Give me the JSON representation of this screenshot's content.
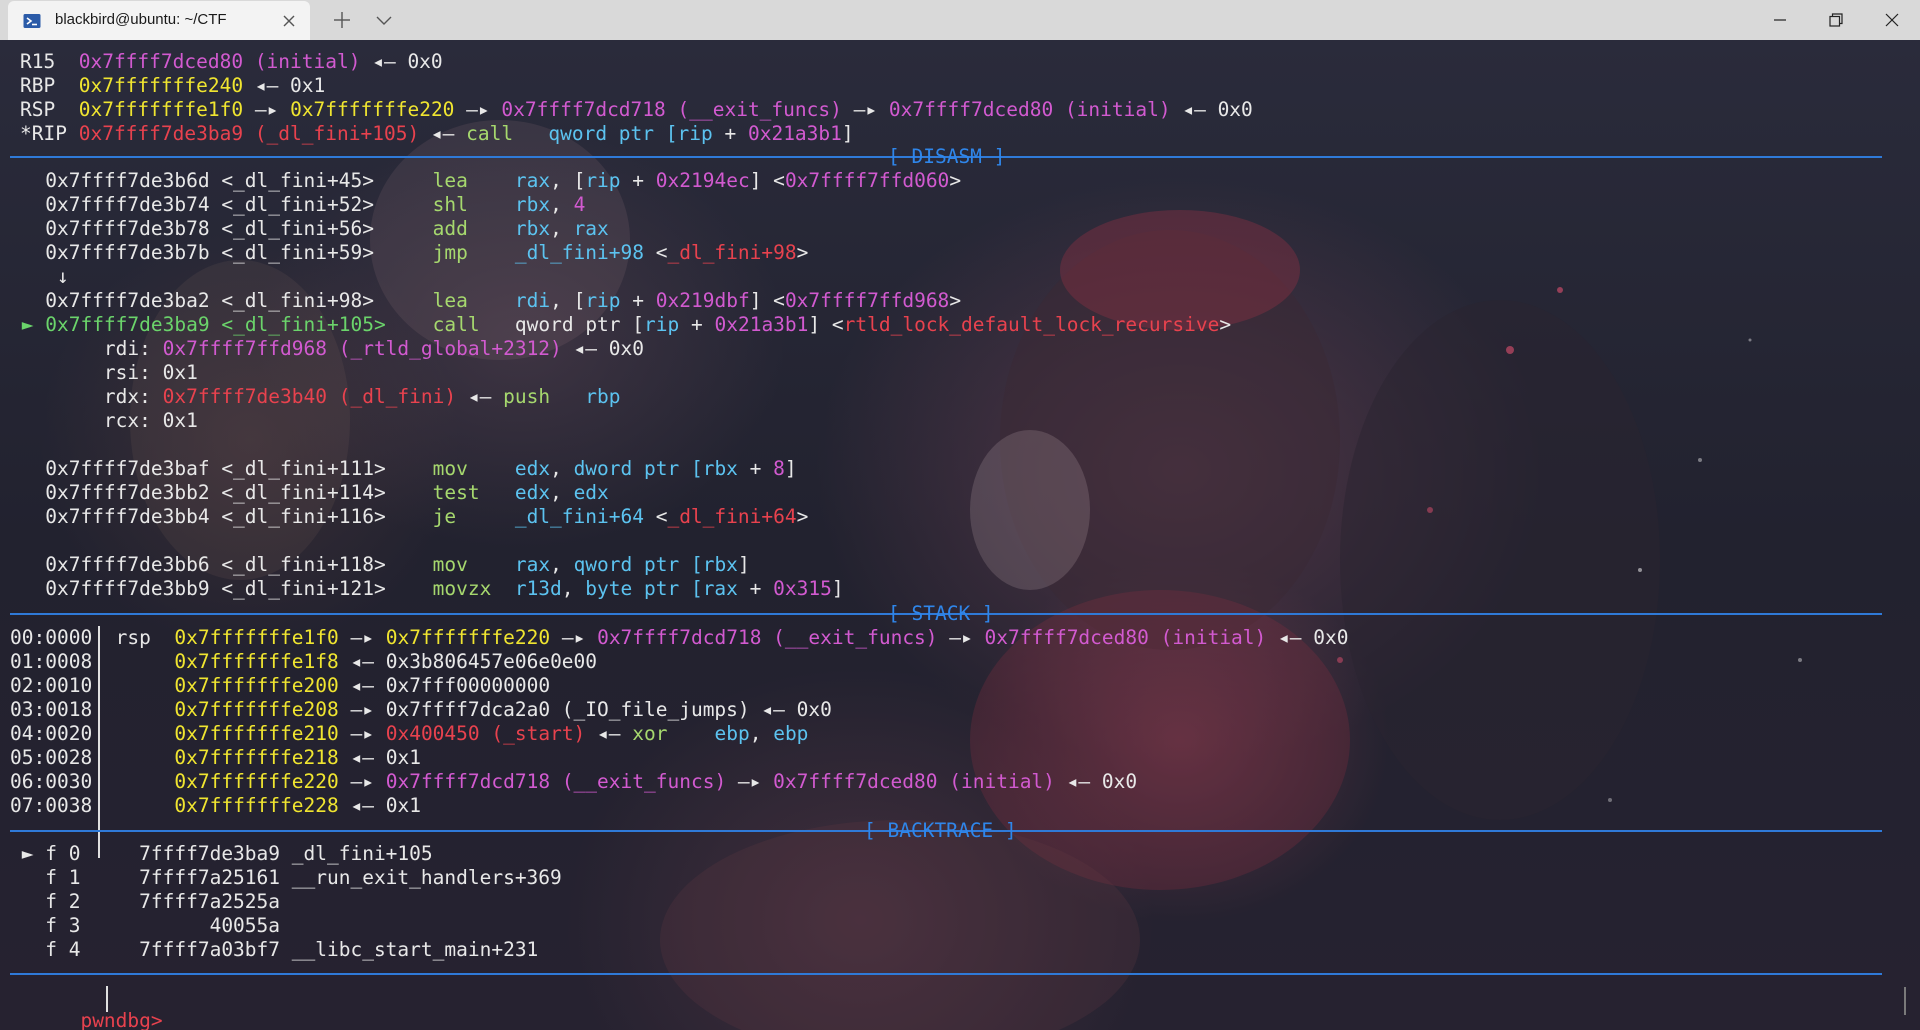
{
  "window": {
    "tab_title": "blackbird@ubuntu: ~/CTF",
    "tab_icon": "terminal-icon"
  },
  "colors": {
    "address_yellow": "#f0e530",
    "symbol_magenta": "#d25ad0",
    "code_red": "#e8424e",
    "current_green": "#6bd46b",
    "mnemonic_green": "#a6d86e",
    "operand_cyan": "#5cc3f0",
    "separator_blue": "#2f7ad8"
  },
  "registers": [
    [
      [
        "R15",
        "w"
      ],
      [
        "  ",
        "w"
      ],
      [
        "0x7ffff7dced80 (initial)",
        "mag"
      ],
      [
        " ◂— 0x0",
        "w"
      ]
    ],
    [
      [
        "RBP",
        "w"
      ],
      [
        "  ",
        "w"
      ],
      [
        "0x7fffffffe240",
        "yel"
      ],
      [
        " ◂— 0x1",
        "w"
      ]
    ],
    [
      [
        "RSP",
        "w"
      ],
      [
        "  ",
        "w"
      ],
      [
        "0x7fffffffe1f0",
        "yel"
      ],
      [
        " —▸ ",
        "w"
      ],
      [
        "0x7fffffffe220",
        "yel"
      ],
      [
        " —▸ ",
        "w"
      ],
      [
        "0x7ffff7dcd718 (__exit_funcs)",
        "mag"
      ],
      [
        " —▸ ",
        "w"
      ],
      [
        "0x7ffff7dced80 (initial)",
        "mag"
      ],
      [
        " ◂— 0x0",
        "w"
      ]
    ],
    [
      [
        "*RIP",
        "w"
      ],
      [
        " ",
        "w"
      ],
      [
        "0x7ffff7de3ba9 (_dl_fini+105)",
        "red"
      ],
      [
        " ◂— ",
        "w"
      ],
      [
        "call",
        "lgr"
      ],
      [
        "   ",
        "w"
      ],
      [
        "qword ptr [",
        "cyn"
      ],
      [
        "rip",
        "cyn"
      ],
      [
        " + ",
        "w"
      ],
      [
        "0x21a3b1",
        "mag"
      ],
      [
        "]",
        "w"
      ]
    ]
  ],
  "sections": {
    "disasm": "[ DISASM ]",
    "stack": "[ STACK ]",
    "backtrace": "[ BACKTRACE ]"
  },
  "disasm": [
    [
      [
        "   0x7ffff7de3b6d <_dl_fini+45>     ",
        "w"
      ],
      [
        "lea",
        "lgr"
      ],
      [
        "    ",
        "w"
      ],
      [
        "rax",
        "cyn"
      ],
      [
        ", ",
        "w"
      ],
      [
        "[",
        "w"
      ],
      [
        "rip",
        "cyn"
      ],
      [
        " + ",
        "w"
      ],
      [
        "0x2194ec",
        "mag"
      ],
      [
        "] <",
        "w"
      ],
      [
        "0x7ffff7ffd060",
        "mag"
      ],
      [
        ">",
        "w"
      ]
    ],
    [
      [
        "   0x7ffff7de3b74 <_dl_fini+52>     ",
        "w"
      ],
      [
        "shl",
        "lgr"
      ],
      [
        "    ",
        "w"
      ],
      [
        "rbx",
        "cyn"
      ],
      [
        ", ",
        "w"
      ],
      [
        "4",
        "mag"
      ]
    ],
    [
      [
        "   0x7ffff7de3b78 <_dl_fini+56>     ",
        "w"
      ],
      [
        "add",
        "lgr"
      ],
      [
        "    ",
        "w"
      ],
      [
        "rbx",
        "cyn"
      ],
      [
        ", ",
        "w"
      ],
      [
        "rax",
        "cyn"
      ]
    ],
    [
      [
        "   0x7ffff7de3b7b <_dl_fini+59>     ",
        "w"
      ],
      [
        "jmp",
        "lgr"
      ],
      [
        "    ",
        "w"
      ],
      [
        "_dl_fini+98",
        "cyn"
      ],
      [
        " <",
        "w"
      ],
      [
        "_dl_fini+98",
        "red"
      ],
      [
        ">",
        "w"
      ]
    ],
    [
      [
        "    ↓",
        "w"
      ]
    ],
    [
      [
        "   0x7ffff7de3ba2 <_dl_fini+98>     ",
        "w"
      ],
      [
        "lea",
        "lgr"
      ],
      [
        "    ",
        "w"
      ],
      [
        "rdi",
        "cyn"
      ],
      [
        ", ",
        "w"
      ],
      [
        "[",
        "w"
      ],
      [
        "rip",
        "cyn"
      ],
      [
        " + ",
        "w"
      ],
      [
        "0x219dbf",
        "mag"
      ],
      [
        "] <",
        "w"
      ],
      [
        "0x7ffff7ffd968",
        "mag"
      ],
      [
        ">",
        "w"
      ]
    ],
    [
      [
        " ► ",
        "grn"
      ],
      [
        "0x7ffff7de3ba9 <_dl_fini+105>",
        "grn"
      ],
      [
        "    ",
        "w"
      ],
      [
        "call",
        "lgr"
      ],
      [
        "   ",
        "w"
      ],
      [
        "qword ptr [",
        "w"
      ],
      [
        "rip",
        "cyn"
      ],
      [
        " + ",
        "w"
      ],
      [
        "0x21a3b1",
        "mag"
      ],
      [
        "] <",
        "w"
      ],
      [
        "rtld_lock_default_lock_recursive",
        "red"
      ],
      [
        ">",
        "w"
      ]
    ],
    [
      [
        "        rdi: ",
        "w"
      ],
      [
        "0x7ffff7ffd968 (_rtld_global+2312)",
        "mag"
      ],
      [
        " ◂— 0x0",
        "w"
      ]
    ],
    [
      [
        "        rsi: 0x1",
        "w"
      ]
    ],
    [
      [
        "        rdx: ",
        "w"
      ],
      [
        "0x7ffff7de3b40 (_dl_fini)",
        "red"
      ],
      [
        " ◂— ",
        "w"
      ],
      [
        "push",
        "lgr"
      ],
      [
        "   ",
        "w"
      ],
      [
        "rbp",
        "cyn"
      ]
    ],
    [
      [
        "        rcx: 0x1",
        "w"
      ]
    ],
    [
      [
        "",
        "w"
      ]
    ],
    [
      [
        "   0x7ffff7de3baf <_dl_fini+111>    ",
        "w"
      ],
      [
        "mov",
        "lgr"
      ],
      [
        "    ",
        "w"
      ],
      [
        "edx",
        "cyn"
      ],
      [
        ", ",
        "w"
      ],
      [
        "dword ptr [",
        "cyn"
      ],
      [
        "rbx",
        "cyn"
      ],
      [
        " + ",
        "w"
      ],
      [
        "8",
        "mag"
      ],
      [
        "]",
        "w"
      ]
    ],
    [
      [
        "   0x7ffff7de3bb2 <_dl_fini+114>    ",
        "w"
      ],
      [
        "test",
        "lgr"
      ],
      [
        "   ",
        "w"
      ],
      [
        "edx",
        "cyn"
      ],
      [
        ", ",
        "w"
      ],
      [
        "edx",
        "cyn"
      ]
    ],
    [
      [
        "   0x7ffff7de3bb4 <_dl_fini+116>    ",
        "w"
      ],
      [
        "je",
        "lgr"
      ],
      [
        "     ",
        "w"
      ],
      [
        "_dl_fini+64",
        "cyn"
      ],
      [
        " <",
        "w"
      ],
      [
        "_dl_fini+64",
        "red"
      ],
      [
        ">",
        "w"
      ]
    ],
    [
      [
        "",
        "w"
      ]
    ],
    [
      [
        "   0x7ffff7de3bb6 <_dl_fini+118>    ",
        "w"
      ],
      [
        "mov",
        "lgr"
      ],
      [
        "    ",
        "w"
      ],
      [
        "rax",
        "cyn"
      ],
      [
        ", ",
        "w"
      ],
      [
        "qword ptr [",
        "cyn"
      ],
      [
        "rbx",
        "cyn"
      ],
      [
        "]",
        "w"
      ]
    ],
    [
      [
        "   0x7ffff7de3bb9 <_dl_fini+121>    ",
        "w"
      ],
      [
        "movzx",
        "lgr"
      ],
      [
        "  ",
        "w"
      ],
      [
        "r13d",
        "cyn"
      ],
      [
        ", ",
        "w"
      ],
      [
        "byte ptr [",
        "cyn"
      ],
      [
        "rax",
        "cyn"
      ],
      [
        " + ",
        "w"
      ],
      [
        "0x315",
        "mag"
      ],
      [
        "]",
        "w"
      ]
    ]
  ],
  "stack": [
    [
      [
        "00:0000",
        "w"
      ],
      [
        "  ",
        "w"
      ],
      [
        "rsp",
        "w"
      ],
      [
        "  ",
        "w"
      ],
      [
        "0x7fffffffe1f0",
        "yel"
      ],
      [
        " —▸ ",
        "w"
      ],
      [
        "0x7fffffffe220",
        "yel"
      ],
      [
        " —▸ ",
        "w"
      ],
      [
        "0x7ffff7dcd718 (__exit_funcs)",
        "mag"
      ],
      [
        " —▸ ",
        "w"
      ],
      [
        "0x7ffff7dced80 (initial)",
        "mag"
      ],
      [
        " ◂— 0x0",
        "w"
      ]
    ],
    [
      [
        "01:0008",
        "w"
      ],
      [
        "       ",
        "w"
      ],
      [
        "0x7fffffffe1f8",
        "yel"
      ],
      [
        " ◂— 0x3b806457e06e0e00",
        "w"
      ]
    ],
    [
      [
        "02:0010",
        "w"
      ],
      [
        "       ",
        "w"
      ],
      [
        "0x7fffffffe200",
        "yel"
      ],
      [
        " ◂— 0x7fff00000000",
        "w"
      ]
    ],
    [
      [
        "03:0018",
        "w"
      ],
      [
        "       ",
        "w"
      ],
      [
        "0x7fffffffe208",
        "yel"
      ],
      [
        " —▸ 0x7ffff7dca2a0 (_IO_file_jumps) ◂— 0x0",
        "w"
      ]
    ],
    [
      [
        "04:0020",
        "w"
      ],
      [
        "       ",
        "w"
      ],
      [
        "0x7fffffffe210",
        "yel"
      ],
      [
        " —▸ ",
        "w"
      ],
      [
        "0x400450 (_start)",
        "red"
      ],
      [
        " ◂— ",
        "w"
      ],
      [
        "xor",
        "lgr"
      ],
      [
        "    ",
        "w"
      ],
      [
        "ebp",
        "cyn"
      ],
      [
        ", ",
        "w"
      ],
      [
        "ebp",
        "cyn"
      ]
    ],
    [
      [
        "05:0028",
        "w"
      ],
      [
        "       ",
        "w"
      ],
      [
        "0x7fffffffe218",
        "yel"
      ],
      [
        " ◂— 0x1",
        "w"
      ]
    ],
    [
      [
        "06:0030",
        "w"
      ],
      [
        "       ",
        "w"
      ],
      [
        "0x7fffffffe220",
        "yel"
      ],
      [
        " —▸ ",
        "w"
      ],
      [
        "0x7ffff7dcd718 (__exit_funcs)",
        "mag"
      ],
      [
        " —▸ ",
        "w"
      ],
      [
        "0x7ffff7dced80 (initial)",
        "mag"
      ],
      [
        " ◂— 0x0",
        "w"
      ]
    ],
    [
      [
        "07:0038",
        "w"
      ],
      [
        "       ",
        "w"
      ],
      [
        "0x7fffffffe228",
        "yel"
      ],
      [
        " ◂— 0x1",
        "w"
      ]
    ]
  ],
  "backtrace": [
    [
      [
        " ► f 0     7ffff7de3ba9 _dl_fini+105",
        "w"
      ]
    ],
    [
      [
        "   f 1     7ffff7a25161 __run_exit_handlers+369",
        "w"
      ]
    ],
    [
      [
        "   f 2     7ffff7a2525a",
        "w"
      ]
    ],
    [
      [
        "   f 3           40055a",
        "w"
      ]
    ],
    [
      [
        "   f 4     7ffff7a03bf7 __libc_start_main+231",
        "w"
      ]
    ]
  ],
  "prompt": "pwndbg> "
}
